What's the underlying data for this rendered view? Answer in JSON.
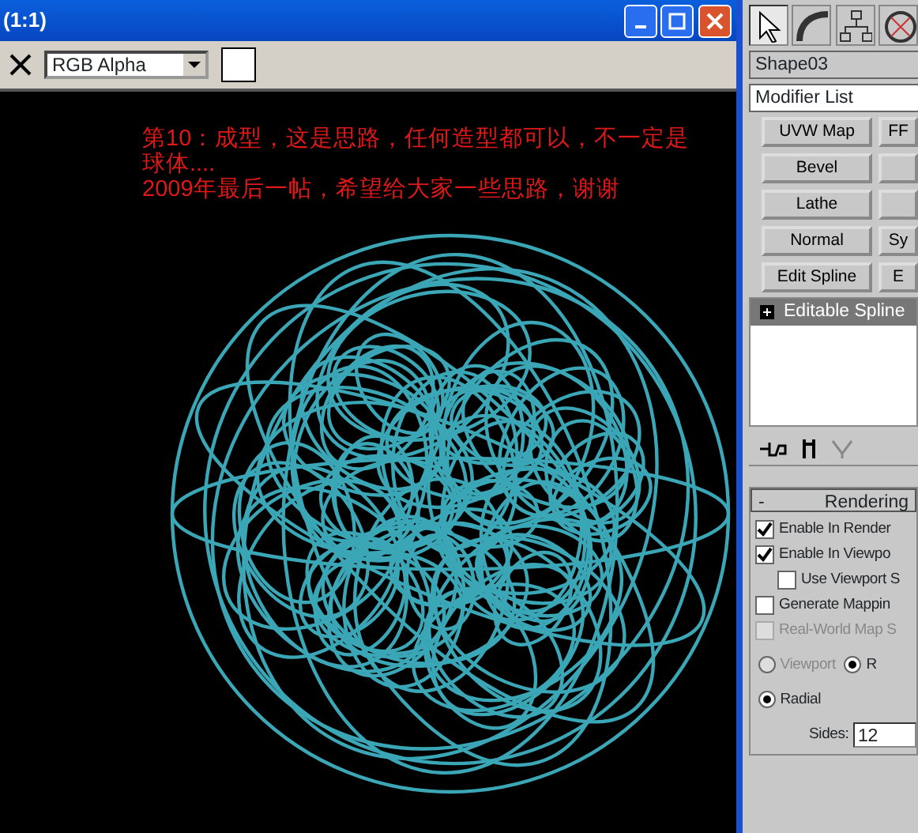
{
  "window": {
    "title": "(1:1)"
  },
  "toolbar": {
    "channel": "RGB Alpha"
  },
  "annotation": {
    "lines": [
      "第10：成型，这是思路，任何造型都可以，不一定是",
      "球体....",
      "2009年最后一帖，希望给大家一些思路，谢谢"
    ]
  },
  "command_panel": {
    "tabs": [
      {
        "kind": "cursor",
        "selected": true
      },
      {
        "kind": "curve",
        "selected": false
      },
      {
        "kind": "hierarchy",
        "selected": false
      },
      {
        "kind": "wheel",
        "selected": false
      }
    ],
    "object_name": "Shape03",
    "modifier_list": "Modifier List",
    "modifier_buttons": [
      {
        "kind": "text",
        "label": "UVW Map"
      },
      {
        "kind": "text",
        "label": "FF"
      },
      {
        "kind": "text",
        "label": "Bevel"
      },
      {
        "kind": "blank"
      },
      {
        "kind": "text",
        "label": "Lathe"
      },
      {
        "kind": "blank"
      },
      {
        "kind": "text",
        "label": "Normal"
      },
      {
        "kind": "text",
        "label": "Sy"
      },
      {
        "kind": "text",
        "label": "Edit Spline"
      },
      {
        "kind": "text",
        "label": "E"
      }
    ],
    "stack": [
      {
        "label": "Editable Spline",
        "expanded": false
      }
    ],
    "rendering": {
      "sign": "-",
      "title": "Rendering",
      "options": [
        {
          "label": "Enable In Render",
          "checked": true,
          "disabled": false
        },
        {
          "label": "Enable In Viewpo",
          "checked": true,
          "disabled": false,
          "children": [
            {
              "label": "Use Viewport S",
              "checked": false,
              "disabled": false
            }
          ]
        },
        {
          "label": "Generate Mappin",
          "checked": false,
          "disabled": false
        },
        {
          "label": "Real-World Map S",
          "checked": false,
          "disabled": true
        }
      ],
      "radios": [
        {
          "label": "Viewport",
          "selected": false,
          "disabled": true
        },
        {
          "label": "R",
          "selected": true,
          "disabled": false
        }
      ],
      "shape_radios": [
        {
          "label": "Radial",
          "selected": true,
          "disabled": false
        }
      ],
      "sides": {
        "label": "Sides:",
        "value": "12"
      }
    }
  }
}
